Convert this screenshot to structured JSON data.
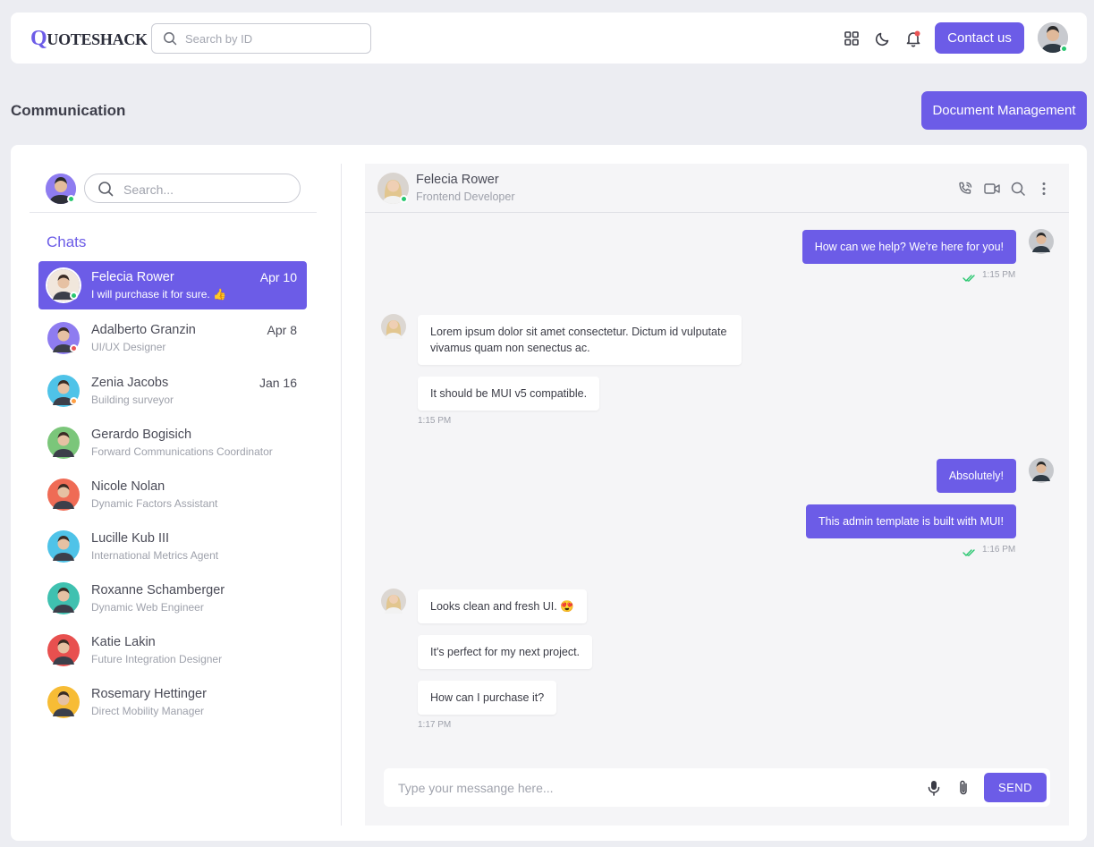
{
  "header": {
    "logo_q": "Q",
    "logo_rest": "UOTESHACK",
    "search_placeholder": "Search by ID",
    "contact_label": "Contact us"
  },
  "page": {
    "title": "Communication",
    "doc_button": "Document Management"
  },
  "sidebar": {
    "search_placeholder": "Search...",
    "chats_title": "Chats",
    "items": [
      {
        "name": "Felecia Rower",
        "sub": "I will purchase it for sure. 👍",
        "date": "Apr 10",
        "status": "#28c76f",
        "bg": "#f1e7dc"
      },
      {
        "name": "Adalberto Granzin",
        "sub": "UI/UX Designer",
        "date": "Apr 8",
        "status": "#ea5455",
        "bg": "#8e7cf0"
      },
      {
        "name": "Zenia Jacobs",
        "sub": "Building surveyor",
        "date": "Jan 16",
        "status": "#ff9f43",
        "bg": "#4fc3e8"
      },
      {
        "name": "Gerardo Bogisich",
        "sub": "Forward Communications Coordinator",
        "date": "",
        "status": "",
        "bg": "#7bc67a"
      },
      {
        "name": "Nicole Nolan",
        "sub": "Dynamic Factors Assistant",
        "date": "",
        "status": "",
        "bg": "#ef6b55"
      },
      {
        "name": "Lucille Kub III",
        "sub": "International Metrics Agent",
        "date": "",
        "status": "",
        "bg": "#4fc3e8"
      },
      {
        "name": "Roxanne Schamberger",
        "sub": "Dynamic Web Engineer",
        "date": "",
        "status": "",
        "bg": "#3fc1b0"
      },
      {
        "name": "Katie Lakin",
        "sub": "Future Integration Designer",
        "date": "",
        "status": "",
        "bg": "#e8504f"
      },
      {
        "name": "Rosemary Hettinger",
        "sub": "Direct Mobility Manager",
        "date": "",
        "status": "",
        "bg": "#f7bc35"
      }
    ]
  },
  "chat": {
    "contact_name": "Felecia Rower",
    "contact_role": "Frontend Developer",
    "messages": [
      {
        "text": "How can we help? We're here for you!"
      },
      {
        "text": "Lorem ipsum dolor sit amet consectetur. Dictum id vulputate vivamus quam non senectus ac."
      },
      {
        "text": "It should be MUI v5 compatible."
      },
      {
        "text": "Absolutely!"
      },
      {
        "text": "This admin template is built with MUI!"
      },
      {
        "text": "Looks clean and fresh UI. 😍"
      },
      {
        "text": "It's perfect for my next project."
      },
      {
        "text": "How can I purchase it?"
      }
    ],
    "times": [
      "1:15 PM",
      "1:15 PM",
      "1:16 PM",
      "1:17 PM"
    ],
    "input_placeholder": "Type your messange here...",
    "send_label": "SEND"
  },
  "colors": {
    "accent": "#6c5ce7",
    "online": "#28c76f",
    "notification": "#ea5455"
  },
  "icons": [
    "search-icon",
    "grid-icon",
    "moon-icon",
    "bell-icon",
    "phone-icon",
    "video-icon",
    "more-vertical-icon",
    "mic-icon",
    "paperclip-icon",
    "double-check-icon"
  ]
}
